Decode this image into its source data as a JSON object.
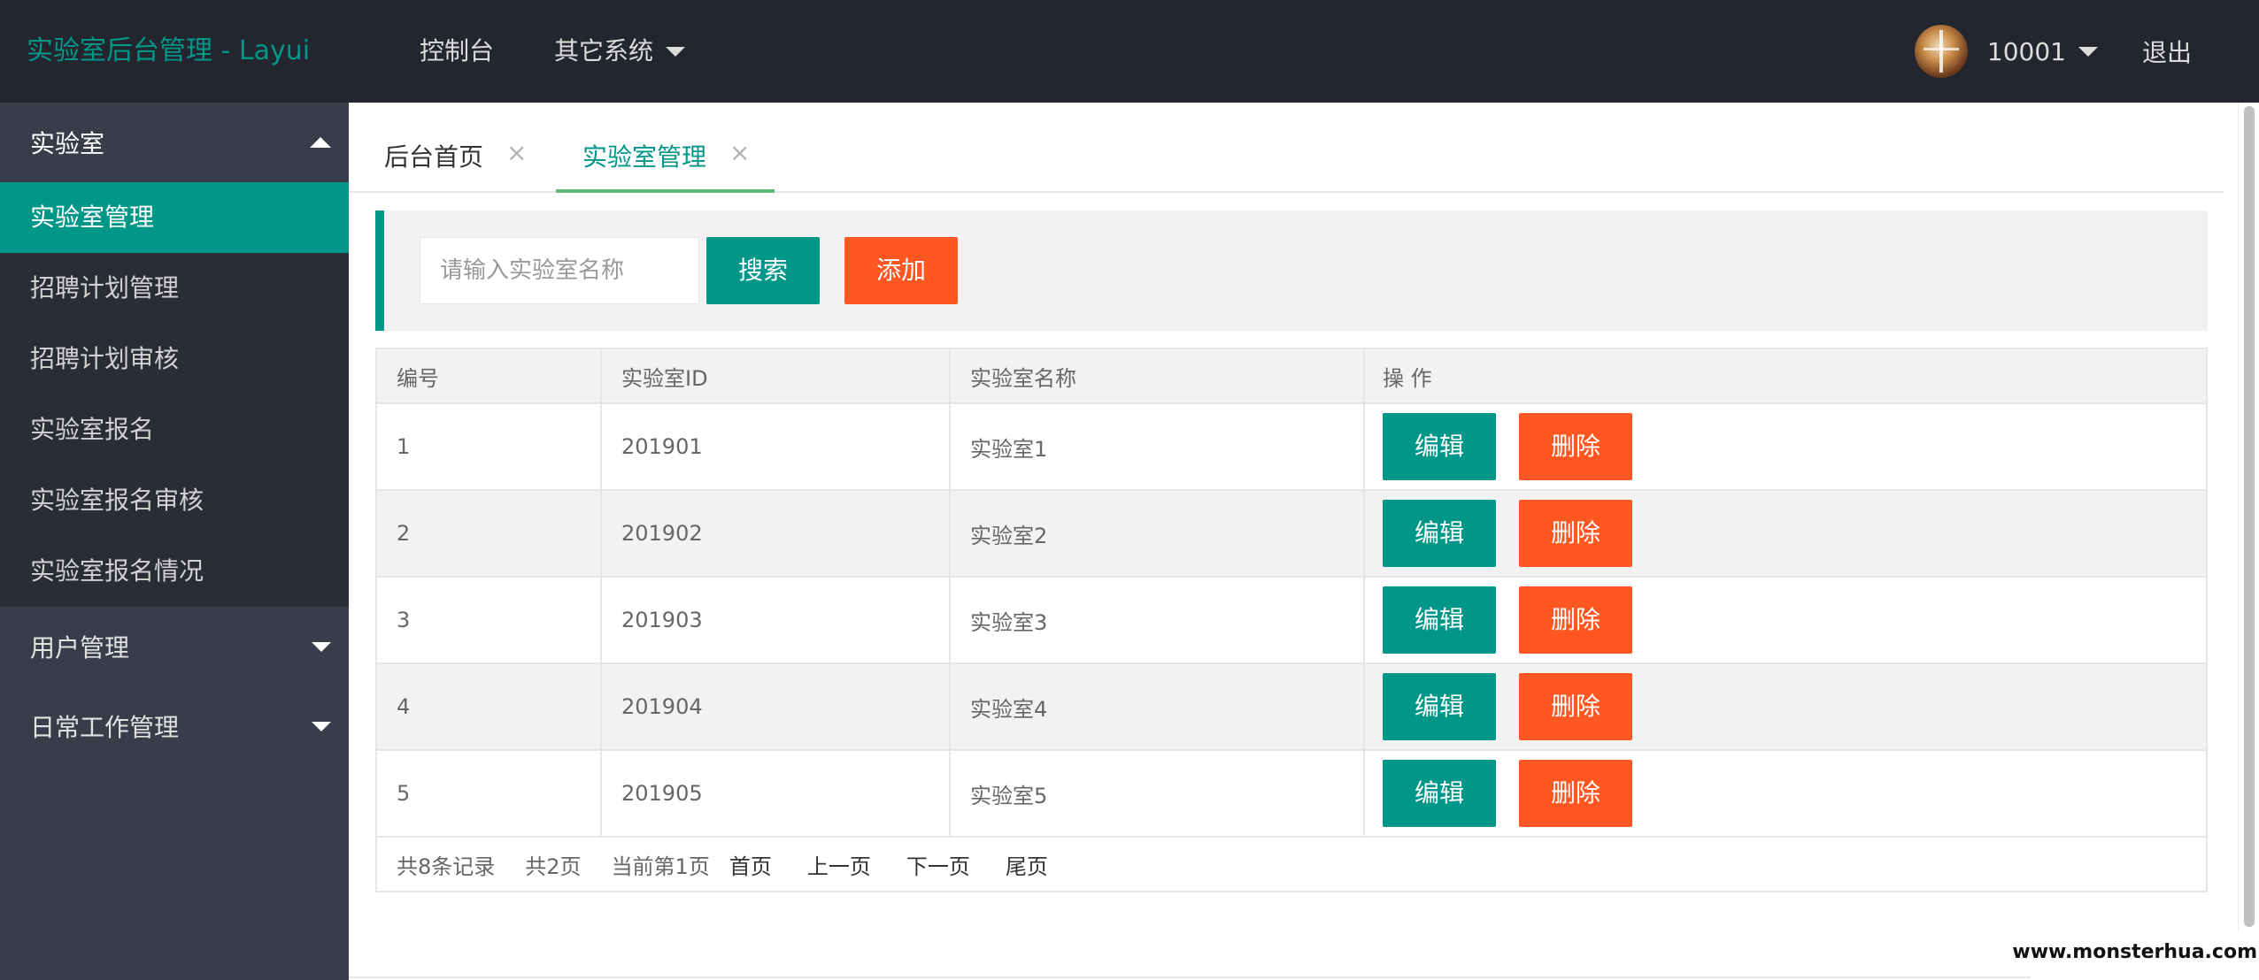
{
  "header": {
    "logo": "实验室后台管理 - Layui",
    "nav": [
      {
        "label": "控制台"
      },
      {
        "label": "其它系统"
      }
    ],
    "user": {
      "name": "10001",
      "logout": "退出"
    }
  },
  "sidebar": {
    "groups": [
      {
        "label": "实验室",
        "expanded": true,
        "items": [
          {
            "label": "实验室管理",
            "active": true
          },
          {
            "label": "招聘计划管理"
          },
          {
            "label": "招聘计划审核"
          },
          {
            "label": "实验室报名"
          },
          {
            "label": "实验室报名审核"
          },
          {
            "label": "实验室报名情况"
          }
        ]
      },
      {
        "label": "用户管理",
        "expanded": false
      },
      {
        "label": "日常工作管理",
        "expanded": false
      }
    ]
  },
  "tabs": [
    {
      "label": "后台首页",
      "close": "×"
    },
    {
      "label": "实验室管理",
      "close": "×",
      "active": true
    }
  ],
  "search": {
    "placeholder": "请输入实验室名称",
    "search_label": "搜索",
    "add_label": "添加"
  },
  "table": {
    "headers": [
      "编号",
      "实验室ID",
      "实验室名称",
      "操 作"
    ],
    "rows": [
      {
        "no": "1",
        "id": "201901",
        "name": "实验室1"
      },
      {
        "no": "2",
        "id": "201902",
        "name": "实验室2"
      },
      {
        "no": "3",
        "id": "201903",
        "name": "实验室3"
      },
      {
        "no": "4",
        "id": "201904",
        "name": "实验室4"
      },
      {
        "no": "5",
        "id": "201905",
        "name": "实验室5"
      }
    ],
    "edit_label": "编辑",
    "delete_label": "删除"
  },
  "pager": {
    "total": "共8条记录",
    "pages": "共2页",
    "current": "当前第1页",
    "first": "首页",
    "prev": "上一页",
    "next": "下一页",
    "last": "尾页"
  },
  "watermark": "www.monsterhua.com",
  "colors": {
    "accent": "#009688",
    "danger": "#ff5722",
    "header_bg": "#23262e",
    "sidebar_bg": "#393d49"
  }
}
